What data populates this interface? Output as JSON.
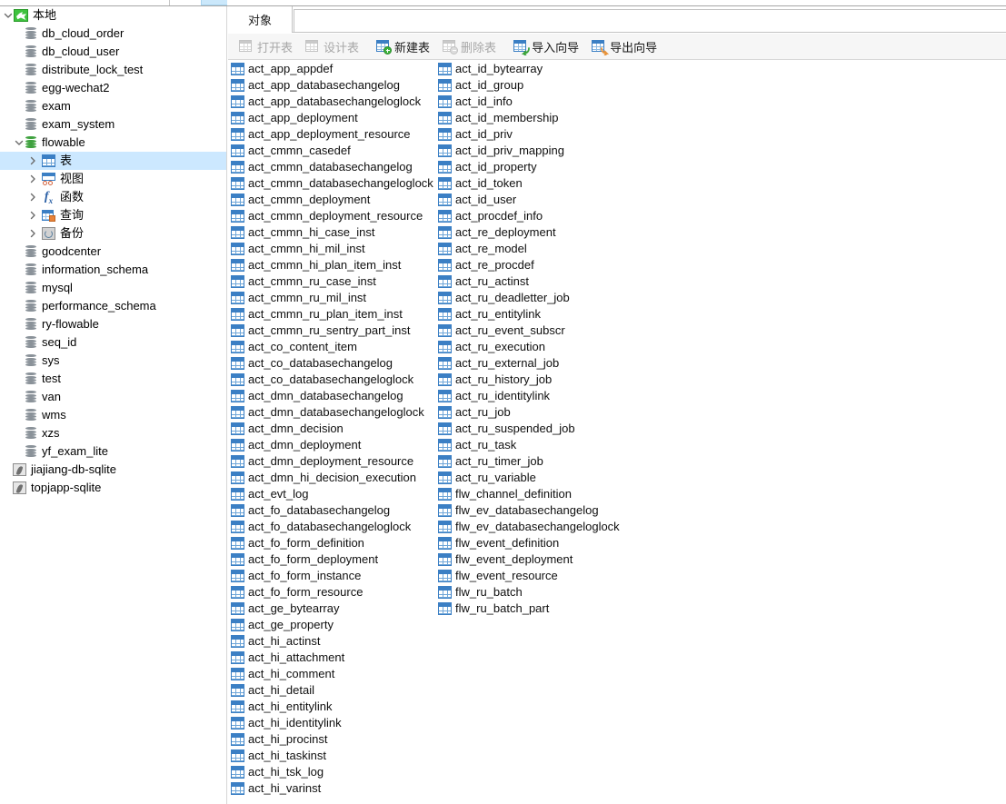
{
  "window": {
    "top_strip_note": "clipped-toolbar-row"
  },
  "sidebar": {
    "connection": {
      "label": "本地",
      "icon": "mysql-connection-icon",
      "expanded": true
    },
    "databases": [
      {
        "label": "db_cloud_order",
        "icon": "database-icon",
        "state": "closed"
      },
      {
        "label": "db_cloud_user",
        "icon": "database-icon",
        "state": "closed"
      },
      {
        "label": "distribute_lock_test",
        "icon": "database-icon",
        "state": "closed"
      },
      {
        "label": "egg-wechat2",
        "icon": "database-icon",
        "state": "closed"
      },
      {
        "label": "exam",
        "icon": "database-icon",
        "state": "closed"
      },
      {
        "label": "exam_system",
        "icon": "database-icon",
        "state": "closed"
      },
      {
        "label": "flowable",
        "icon": "database-icon",
        "state": "open",
        "expanded": true
      },
      {
        "label": "goodcenter",
        "icon": "database-icon",
        "state": "closed"
      },
      {
        "label": "information_schema",
        "icon": "database-icon",
        "state": "closed"
      },
      {
        "label": "mysql",
        "icon": "database-icon",
        "state": "closed"
      },
      {
        "label": "performance_schema",
        "icon": "database-icon",
        "state": "closed"
      },
      {
        "label": "ry-flowable",
        "icon": "database-icon",
        "state": "closed"
      },
      {
        "label": "seq_id",
        "icon": "database-icon",
        "state": "closed"
      },
      {
        "label": "sys",
        "icon": "database-icon",
        "state": "closed"
      },
      {
        "label": "test",
        "icon": "database-icon",
        "state": "closed"
      },
      {
        "label": "van",
        "icon": "database-icon",
        "state": "closed"
      },
      {
        "label": "wms",
        "icon": "database-icon",
        "state": "closed"
      },
      {
        "label": "xzs",
        "icon": "database-icon",
        "state": "closed"
      },
      {
        "label": "yf_exam_lite",
        "icon": "database-icon",
        "state": "closed"
      }
    ],
    "flowable_children": [
      {
        "label": "表",
        "icon": "table-grid-icon",
        "selected": true
      },
      {
        "label": "视图",
        "icon": "view-icon",
        "selected": false
      },
      {
        "label": "函数",
        "icon": "function-fx-icon",
        "selected": false
      },
      {
        "label": "查询",
        "icon": "query-icon",
        "selected": false
      },
      {
        "label": "备份",
        "icon": "backup-icon",
        "selected": false
      }
    ],
    "sqlite_connections": [
      {
        "label": "jiajiang-db-sqlite",
        "icon": "sqlite-connection-icon"
      },
      {
        "label": "topjapp-sqlite",
        "icon": "sqlite-connection-icon"
      }
    ],
    "selection_color": "#cce8ff"
  },
  "tabs": [
    {
      "label": "对象",
      "active": true
    }
  ],
  "toolbar": {
    "buttons": [
      {
        "label": "打开表",
        "icon": "open-table-icon",
        "enabled": false
      },
      {
        "label": "设计表",
        "icon": "design-table-icon",
        "enabled": false
      },
      {
        "label": "新建表",
        "icon": "new-table-icon",
        "enabled": true
      },
      {
        "label": "删除表",
        "icon": "delete-table-icon",
        "enabled": false
      },
      {
        "label": "导入向导",
        "icon": "import-wizard-icon",
        "enabled": true
      },
      {
        "label": "导出向导",
        "icon": "export-wizard-icon",
        "enabled": true
      }
    ]
  },
  "table_list": {
    "icon": "table-grid-icon",
    "column1": [
      "act_app_appdef",
      "act_app_databasechangelog",
      "act_app_databasechangeloglock",
      "act_app_deployment",
      "act_app_deployment_resource",
      "act_cmmn_casedef",
      "act_cmmn_databasechangelog",
      "act_cmmn_databasechangeloglock",
      "act_cmmn_deployment",
      "act_cmmn_deployment_resource",
      "act_cmmn_hi_case_inst",
      "act_cmmn_hi_mil_inst",
      "act_cmmn_hi_plan_item_inst",
      "act_cmmn_ru_case_inst",
      "act_cmmn_ru_mil_inst",
      "act_cmmn_ru_plan_item_inst",
      "act_cmmn_ru_sentry_part_inst",
      "act_co_content_item",
      "act_co_databasechangelog",
      "act_co_databasechangeloglock",
      "act_dmn_databasechangelog",
      "act_dmn_databasechangeloglock",
      "act_dmn_decision",
      "act_dmn_deployment",
      "act_dmn_deployment_resource",
      "act_dmn_hi_decision_execution",
      "act_evt_log",
      "act_fo_databasechangelog",
      "act_fo_databasechangeloglock",
      "act_fo_form_definition",
      "act_fo_form_deployment",
      "act_fo_form_instance",
      "act_fo_form_resource",
      "act_ge_bytearray",
      "act_ge_property",
      "act_hi_actinst",
      "act_hi_attachment",
      "act_hi_comment",
      "act_hi_detail",
      "act_hi_entitylink",
      "act_hi_identitylink",
      "act_hi_procinst",
      "act_hi_taskinst",
      "act_hi_tsk_log",
      "act_hi_varinst"
    ],
    "column2": [
      "act_id_bytearray",
      "act_id_group",
      "act_id_info",
      "act_id_membership",
      "act_id_priv",
      "act_id_priv_mapping",
      "act_id_property",
      "act_id_token",
      "act_id_user",
      "act_procdef_info",
      "act_re_deployment",
      "act_re_model",
      "act_re_procdef",
      "act_ru_actinst",
      "act_ru_deadletter_job",
      "act_ru_entitylink",
      "act_ru_event_subscr",
      "act_ru_execution",
      "act_ru_external_job",
      "act_ru_history_job",
      "act_ru_identitylink",
      "act_ru_job",
      "act_ru_suspended_job",
      "act_ru_task",
      "act_ru_timer_job",
      "act_ru_variable",
      "flw_channel_definition",
      "flw_ev_databasechangelog",
      "flw_ev_databasechangeloglock",
      "flw_event_definition",
      "flw_event_deployment",
      "flw_event_resource",
      "flw_ru_batch",
      "flw_ru_batch_part"
    ]
  },
  "colors": {
    "accent_blue": "#3b7fc4",
    "selection": "#cce8ff",
    "toolbar_bg": "#f6f6f6",
    "db_green": "#3fa23f",
    "db_gray": "#8a9299"
  }
}
